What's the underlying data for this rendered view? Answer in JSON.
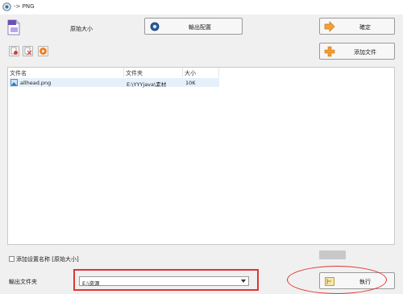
{
  "window": {
    "title": "-> PNG"
  },
  "header": {
    "original_size_label": "原始大小"
  },
  "buttons": {
    "output_config": "輸出配置",
    "confirm": "確定",
    "add_file": "添加文件",
    "start": "執行"
  },
  "file_list": {
    "columns": [
      "文件名",
      "文件夹",
      "大小"
    ],
    "rows": [
      {
        "name": "allhead.png",
        "folder": "E:\\YYYjava\\素材",
        "size": "10K"
      }
    ]
  },
  "options": {
    "add_setting_name_label": "添加设置名称 [原始大小]"
  },
  "output": {
    "folder_label": "輸出文件夹",
    "folder_value": "E:\\资源"
  },
  "colors": {
    "annotation": "#e03434"
  }
}
